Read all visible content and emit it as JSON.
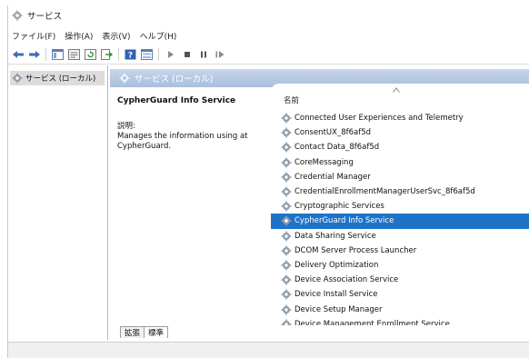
{
  "window": {
    "title": "サービス"
  },
  "menu": [
    "ファイル(F)",
    "操作(A)",
    "表示(V)",
    "ヘルプ(H)"
  ],
  "toolbar": {
    "buttons": [
      "back-arrow-icon",
      "forward-arrow-icon",
      "console-tree-icon",
      "properties-icon",
      "refresh-icon",
      "export-list-icon",
      "help-icon",
      "view-icon",
      "play-icon",
      "stop-icon",
      "pause-icon",
      "resume-icon"
    ]
  },
  "tree": {
    "root_label": "サービス (ローカル)"
  },
  "main": {
    "header_label": "サービス (ローカル)",
    "selected_service": "CypherGuard Info Service",
    "description_heading": "説明:",
    "description_text": "Manages the information using at CypherGuard.",
    "column_name": "名前",
    "services": [
      "Connected User Experiences and Telemetry",
      "ConsentUX_8f6af5d",
      "Contact Data_8f6af5d",
      "CoreMessaging",
      "Credential Manager",
      "CredentialEnrollmentManagerUserSvc_8f6af5d",
      "Cryptographic Services",
      "CypherGuard Info Service",
      "Data Sharing Service",
      "DCOM Server Process Launcher",
      "Delivery Optimization",
      "Device Association Service",
      "Device Install Service",
      "Device Setup Manager",
      "Device Management Enrollment Service"
    ],
    "selected_index": 7,
    "tabs": [
      "拡張",
      "標準"
    ]
  },
  "colors": {
    "selection": "#1e73c9",
    "header_gradient_top": "#c6d5ea",
    "header_gradient_bottom": "#a9bfdd"
  }
}
